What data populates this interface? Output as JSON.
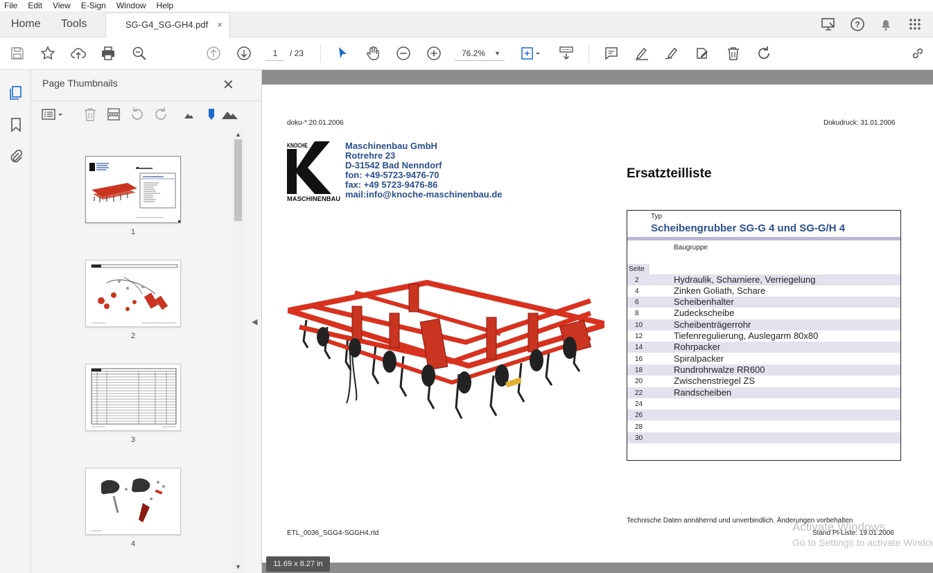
{
  "menu": [
    "File",
    "Edit",
    "View",
    "E-Sign",
    "Window",
    "Help"
  ],
  "tabs": {
    "home": "Home",
    "tools": "Tools",
    "document": "SG-G4_SG-GH4.pdf",
    "close": "×"
  },
  "toolbar": {
    "page_current": "1",
    "page_total": "/ 23",
    "zoom": "76.2%"
  },
  "sidebar": {
    "title": "Page Thumbnails",
    "close": "✕"
  },
  "thumbnails": [
    {
      "label": "1"
    },
    {
      "label": "2"
    },
    {
      "label": "3"
    },
    {
      "label": "4"
    }
  ],
  "document": {
    "doku": "doku-*:20.01.2006",
    "dokudruck": "Dokudruck: 31.01.2006",
    "logo_top": "KNOCHE",
    "logo_letter": "K",
    "logo_bottom": "MASCHINENBAU",
    "company": [
      "Maschinenbau GmbH",
      "Rotrehre 23",
      "D-31542 Bad Nenndorf",
      "fon: +49-5723-9476-70",
      "fax: +49 5723-9476-86",
      "mail:info@knoche-maschinenbau.de"
    ],
    "heading": "Ersatzteilliste",
    "typ_label": "Typ",
    "typ_title": "Scheibengrubber SG-G 4 und SG-G/H 4",
    "baugruppe_label": "Baugruppe",
    "seite_label": "Seite",
    "parts": [
      {
        "page": "2",
        "name": "Hydraulik, Scharniere, Verriegelung"
      },
      {
        "page": "4",
        "name": "Zinken Goliath, Schare"
      },
      {
        "page": "6",
        "name": "Scheibenhalter"
      },
      {
        "page": "8",
        "name": "Zudeckscheibe"
      },
      {
        "page": "10",
        "name": "Scheibenträgerrohr"
      },
      {
        "page": "12",
        "name": "Tiefenregulierung, Auslegarm 80x80"
      },
      {
        "page": "14",
        "name": "Rohrpacker"
      },
      {
        "page": "16",
        "name": "Spiralpacker"
      },
      {
        "page": "18",
        "name": "Rundrohrwalze RR600"
      },
      {
        "page": "20",
        "name": "Zwischenstriegel ZS"
      },
      {
        "page": "22",
        "name": "Randscheiben"
      },
      {
        "page": "24",
        "name": ""
      },
      {
        "page": "26",
        "name": ""
      },
      {
        "page": "28",
        "name": ""
      },
      {
        "page": "30",
        "name": ""
      }
    ],
    "disclaimer": "Technische Daten annähernd und unverbindlich. Änderungen vorbehalten",
    "filename": "ETL_0036_SGG4-SGGH4.rtd",
    "stand": "Stand Pl-Liste: 19.01.2006"
  },
  "page_size_badge": "11.69 x 8.27 in",
  "watermark": {
    "line1": "Activate Windows",
    "line2": "Go to Settings to activate Windows."
  },
  "colors": {
    "brand_blue": "#2a4f8c",
    "machine_red": "#d8321f",
    "row_shade": "#e2e2ef"
  }
}
